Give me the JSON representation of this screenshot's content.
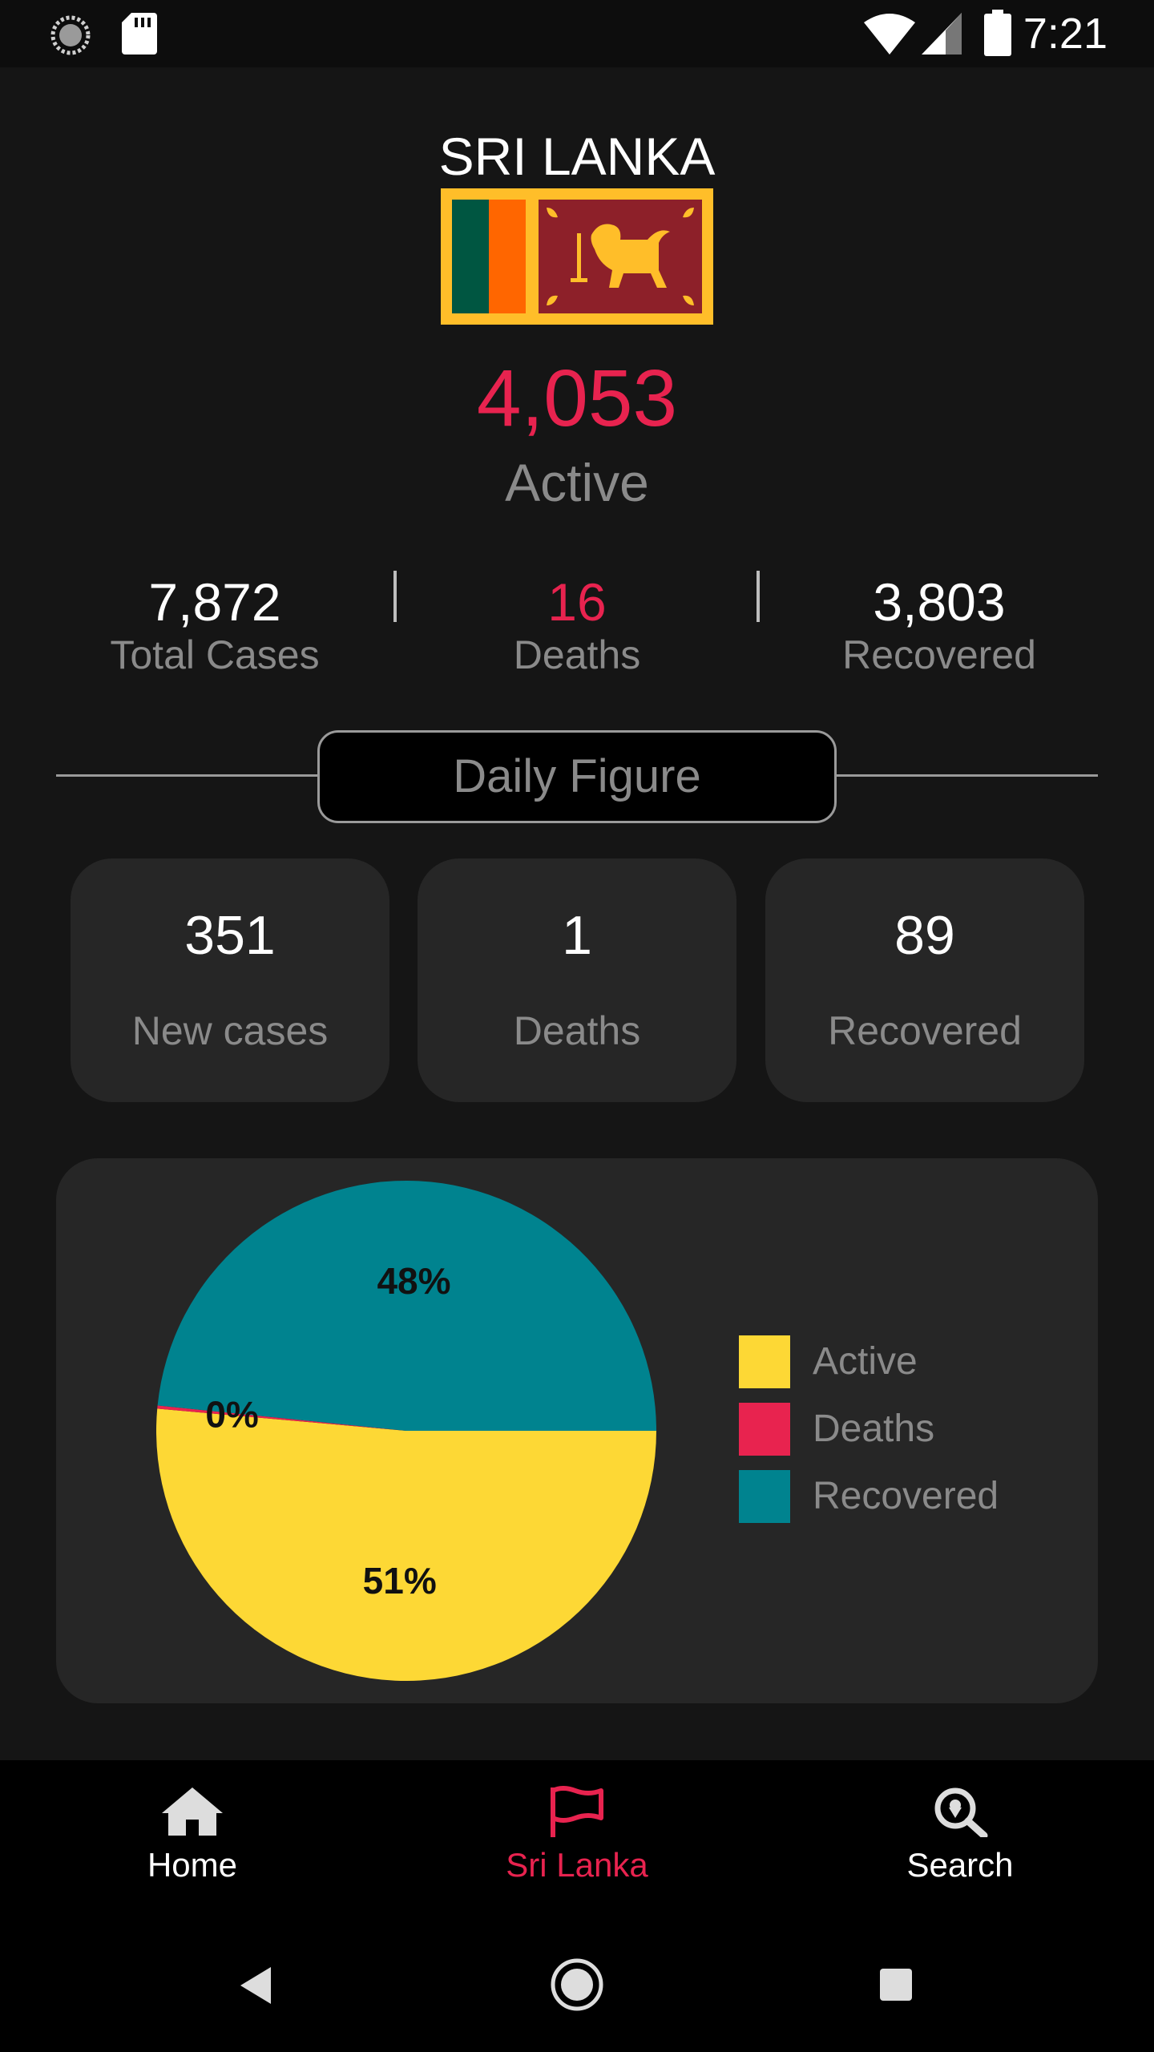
{
  "status_bar": {
    "time": "7:21",
    "icons": [
      "loading-icon",
      "sd-card-icon",
      "wifi-icon",
      "signal-icon",
      "battery-icon"
    ]
  },
  "country": {
    "name": "SRI LANKA",
    "flag": "sri-lanka-flag"
  },
  "summary": {
    "active_value": "4,053",
    "active_label": "Active",
    "total_cases_value": "7,872",
    "total_cases_label": "Total Cases",
    "deaths_value": "16",
    "deaths_label": "Deaths",
    "recovered_value": "3,803",
    "recovered_label": "Recovered"
  },
  "daily": {
    "title": "Daily Figure",
    "cards": [
      {
        "value": "351",
        "label": "New cases"
      },
      {
        "value": "1",
        "label": "Deaths"
      },
      {
        "value": "89",
        "label": "Recovered"
      }
    ]
  },
  "chart_data": {
    "type": "pie",
    "slices": [
      {
        "label": "Active",
        "value": 51,
        "display": "51%",
        "color": "#fdd835"
      },
      {
        "label": "Deaths",
        "value": 0.2,
        "display": "0%",
        "color": "#e8234f"
      },
      {
        "label": "Recovered",
        "value": 48,
        "display": "48%",
        "color": "#00838f"
      }
    ],
    "legend": [
      "Active",
      "Deaths",
      "Recovered"
    ],
    "legend_placement": "right"
  },
  "bottom_nav": {
    "items": [
      {
        "label": "Home",
        "icon": "home-icon",
        "active": false
      },
      {
        "label": "Sri Lanka",
        "icon": "flag-icon",
        "active": true
      },
      {
        "label": "Search",
        "icon": "search-location-icon",
        "active": false
      }
    ]
  },
  "colors": {
    "accent": "#e8234f",
    "background": "#151515",
    "card": "#262626",
    "muted_text": "#8a8a8a"
  }
}
